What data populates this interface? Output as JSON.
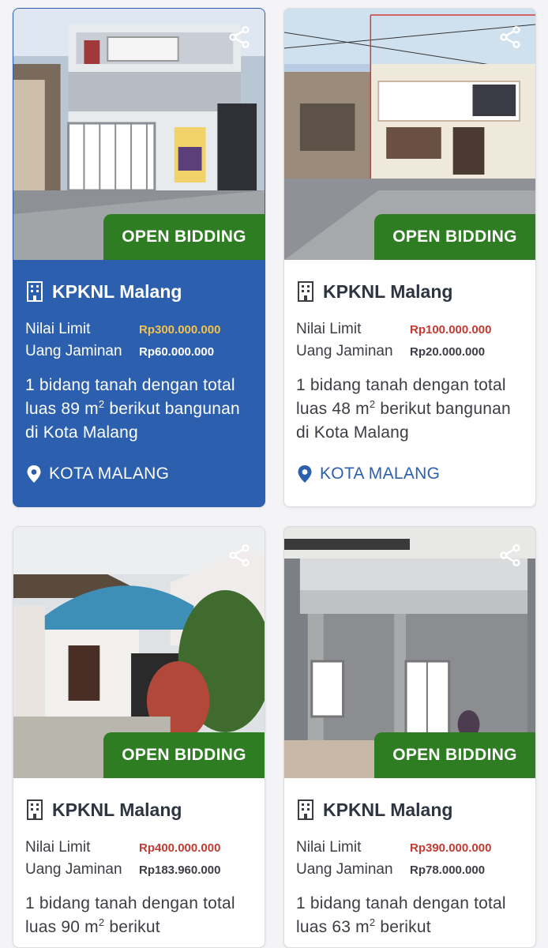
{
  "colors": {
    "selected_card": "#2c5fae",
    "badge_green": "#2f7d22",
    "limit_red": "#c23b33",
    "limit_gold": "#f2c14e",
    "location_blue": "#2c5fae"
  },
  "listings": [
    {
      "photo_alt": "two-storey house with white gate and food cart",
      "share_icon": "share-icon",
      "status": "OPEN BIDDING",
      "office_icon": "building-icon",
      "office": "KPKNL Malang",
      "limit_label": "Nilai Limit",
      "limit_value": "Rp300.000.000",
      "deposit_label": "Uang Jaminan",
      "deposit_value": "Rp60.000.000",
      "desc_before": "1 bidang tanah dengan total luas 89 m",
      "desc_sup": "2",
      "desc_after": " berikut bangunan di Kota Malang",
      "location_icon": "location-pin-icon",
      "location": "KOTA MALANG"
    },
    {
      "photo_alt": "street view of shop house with salon sign",
      "share_icon": "share-icon",
      "status": "OPEN BIDDING",
      "office_icon": "building-icon",
      "office": "KPKNL Malang",
      "limit_label": "Nilai Limit",
      "limit_value": "Rp100.000.000",
      "deposit_label": "Uang Jaminan",
      "deposit_value": "Rp20.000.000",
      "desc_before": "1 bidang tanah dengan total luas 48 m",
      "desc_sup": "2",
      "desc_after": " berikut bangunan di Kota Malang",
      "location_icon": "location-pin-icon",
      "location": "KOTA MALANG"
    },
    {
      "photo_alt": "house with blue carport roof and garden",
      "share_icon": "share-icon",
      "status": "OPEN BIDDING",
      "office_icon": "building-icon",
      "office": "KPKNL Malang",
      "limit_label": "Nilai Limit",
      "limit_value": "Rp400.000.000",
      "deposit_label": "Uang Jaminan",
      "deposit_value": "Rp183.960.000",
      "desc_before": "1 bidang tanah dengan total luas 90 m",
      "desc_sup": "2",
      "desc_after": " berikut",
      "location_icon": "location-pin-icon",
      "location": ""
    },
    {
      "photo_alt": "grey two-storey house with white doors",
      "share_icon": "share-icon",
      "status": "OPEN BIDDING",
      "office_icon": "building-icon",
      "office": "KPKNL Malang",
      "limit_label": "Nilai Limit",
      "limit_value": "Rp390.000.000",
      "deposit_label": "Uang Jaminan",
      "deposit_value": "Rp78.000.000",
      "desc_before": "1 bidang tanah dengan total luas 63 m",
      "desc_sup": "2",
      "desc_after": " berikut",
      "location_icon": "location-pin-icon",
      "location": ""
    }
  ]
}
